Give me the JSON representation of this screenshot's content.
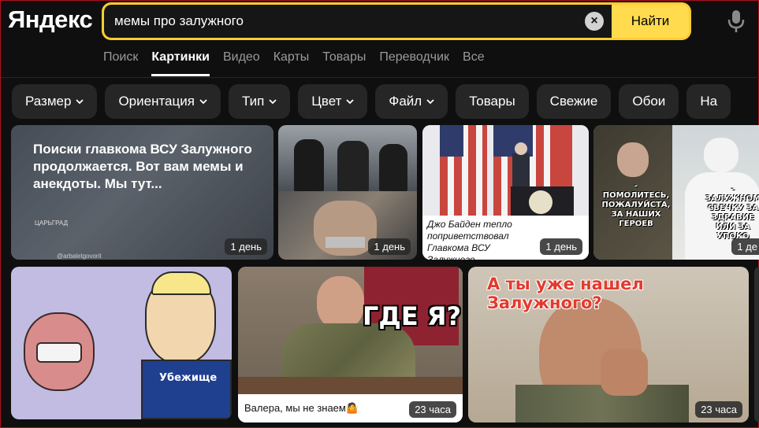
{
  "header": {
    "logo": "Яндекс",
    "search": {
      "value": "мемы про залужного",
      "find_label": "Найти"
    }
  },
  "tabs": [
    {
      "label": "Поиск"
    },
    {
      "label": "Картинки",
      "active": true
    },
    {
      "label": "Видео"
    },
    {
      "label": "Карты"
    },
    {
      "label": "Товары"
    },
    {
      "label": "Переводчик"
    },
    {
      "label": "Все"
    }
  ],
  "filters": [
    {
      "label": "Размер",
      "dropdown": true
    },
    {
      "label": "Ориентация",
      "dropdown": true
    },
    {
      "label": "Тип",
      "dropdown": true
    },
    {
      "label": "Цвет",
      "dropdown": true
    },
    {
      "label": "Файл",
      "dropdown": true
    },
    {
      "label": "Товары",
      "dropdown": false
    },
    {
      "label": "Свежие",
      "dropdown": false
    },
    {
      "label": "Обои",
      "dropdown": false
    },
    {
      "label": "На",
      "dropdown": false
    }
  ],
  "results": {
    "r1": {
      "title": "Поиски главкома ВСУ Залужного продолжается. Вот вам мемы и анекдоты. Мы тут...",
      "age": "1 день",
      "source_mark": "ЦАРЬГРАД",
      "watermark": "@arbaletgovorit"
    },
    "r2": {
      "age": "1 день"
    },
    "r3": {
      "caption": "Джо Байден тепло поприветствовал Главкома ВСУ Залужного.",
      "age": "1 день"
    },
    "r4": {
      "age": "1 де",
      "meme_left": "- ПОМОЛИТЕСЬ, ПОЖАЛУЙСТА, ЗА НАШИХ ГЕРОЕВ",
      "meme_right": "- ЗАЛУЖНОМ СВЕЧКУ ЗА ЗДРАВИЕ ИЛИ ЗА УПОКО"
    },
    "r5": {
      "shirt_text": "Убежище"
    },
    "r6": {
      "meme_text": "ГДЕ Я?",
      "caption": "Валера, мы не знаем🤷",
      "age": "23 часа"
    },
    "r7": {
      "meme_text": "А ты уже нашел Залужного?",
      "age": "23 часа"
    }
  },
  "colors": {
    "accent": "#ffdb4d",
    "background": "#0f0f0f",
    "chip": "#262626"
  }
}
